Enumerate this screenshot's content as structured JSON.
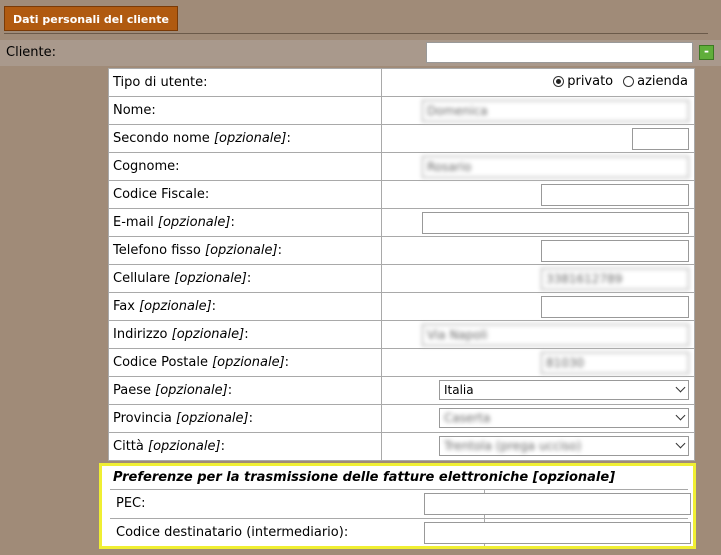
{
  "header": {
    "tab_label": "Dati personali del cliente"
  },
  "client": {
    "label": "Cliente:",
    "value": "",
    "add_button": "-"
  },
  "form": {
    "optional_suffix": "[opzionale]",
    "user_type": {
      "label": "Tipo di utente:",
      "options": [
        "privato",
        "azienda"
      ],
      "selected": "privato"
    },
    "rows": [
      {
        "label": "Nome:",
        "optional": false,
        "value": "Domenica"
      },
      {
        "label": "Secondo nome",
        "optional": true,
        "value": ""
      },
      {
        "label": "Cognome:",
        "optional": false,
        "value": "Rosario"
      },
      {
        "label": "Codice Fiscale:",
        "optional": false,
        "value": ""
      },
      {
        "label": "E-mail",
        "optional": true,
        "value": ""
      },
      {
        "label": "Telefono fisso",
        "optional": true,
        "value": ""
      },
      {
        "label": "Cellulare",
        "optional": true,
        "value": "3381612789"
      },
      {
        "label": "Fax",
        "optional": true,
        "value": ""
      },
      {
        "label": "Indirizzo",
        "optional": true,
        "value": "Via Napoli"
      },
      {
        "label": "Codice Postale",
        "optional": true,
        "value": "81030"
      },
      {
        "label": "Paese",
        "optional": true,
        "value": "Italia"
      },
      {
        "label": "Provincia",
        "optional": true,
        "value": "Caserta"
      },
      {
        "label": "Città",
        "optional": true,
        "value": "Trentola (prega ucciso)"
      }
    ]
  },
  "einvoice": {
    "title": "Preferenze per la trasmissione delle fatture elettroniche [opzionale]",
    "pec_label": "PEC:",
    "pec_value": "",
    "recipient_code_label": "Codice destinatario (intermediario):",
    "recipient_code_value": ""
  },
  "colors": {
    "background": "#a08b78",
    "tab": "#b05a10",
    "highlight": "#f0ef33",
    "add_button": "#5fae3a"
  }
}
